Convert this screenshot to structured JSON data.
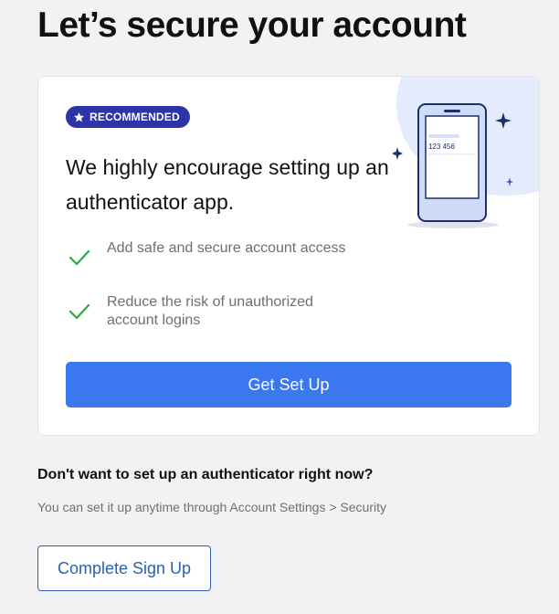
{
  "page": {
    "title": "Let’s secure your account"
  },
  "card": {
    "badge": "RECOMMENDED",
    "heading": "We highly encourage setting up an authenticator app.",
    "benefits": [
      {
        "text": "Add safe and secure account access"
      },
      {
        "text": "Reduce the risk of unauthorized account logins"
      }
    ],
    "illustration": {
      "code": "123 456"
    },
    "primary_button": "Get Set Up"
  },
  "later": {
    "title": "Don't want to set up an authenticator right now?",
    "subtitle": "You can set it up anytime through Account Settings > Security",
    "button": "Complete Sign Up"
  },
  "colors": {
    "primary": "#3b78f0",
    "badge": "#2c35a8",
    "check": "#2bab3a",
    "outline_button": "#2c5fb0"
  },
  "icons": [
    "star-icon",
    "checkmark-icon",
    "phone-illustration",
    "sparkle-icon"
  ]
}
